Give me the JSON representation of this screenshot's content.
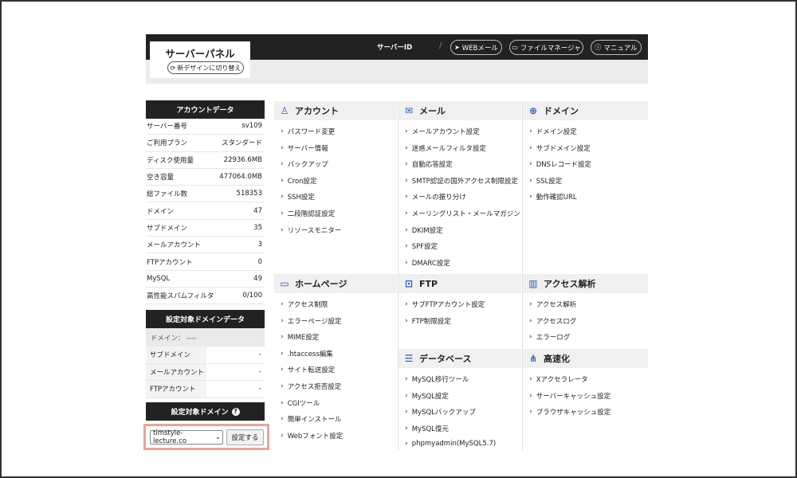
{
  "header": {
    "title": "サーバーパネル",
    "switch_label": "新デザインに切り替え",
    "server_id_label": "サーバーID",
    "slash": "/",
    "webmail_label": "WEBメール",
    "filemanager_label": "ファイルマネージャ",
    "manual_label": "マニュアル"
  },
  "account": {
    "title": "アカウントデータ",
    "rows": [
      {
        "label": "サーバー番号",
        "value": "sv109"
      },
      {
        "label": "ご利用プラン",
        "value": "スタンダード"
      },
      {
        "label": "ディスク使用量",
        "value": "22936.6MB"
      },
      {
        "label": "空き容量",
        "value": "477064.0MB"
      },
      {
        "label": "総ファイル数",
        "value": "518353"
      },
      {
        "label": "ドメイン",
        "value": "47"
      },
      {
        "label": "サブドメイン",
        "value": "35"
      },
      {
        "label": "メールアカウント",
        "value": "3"
      },
      {
        "label": "FTPアカウント",
        "value": "0"
      },
      {
        "label": "MySQL",
        "value": "49"
      },
      {
        "label": "高性能スパムフィルタ",
        "value": "0/100"
      }
    ]
  },
  "domain_data": {
    "title": "設定対象ドメインデータ",
    "domain_line": "ドメイン： ----",
    "rows": [
      {
        "label": "サブドメイン",
        "value": "-"
      },
      {
        "label": "メールアカウント",
        "value": "-"
      },
      {
        "label": "FTPアカウント",
        "value": "-"
      }
    ]
  },
  "target_domain": {
    "title": "設定対象ドメイン",
    "help": "?",
    "selected": "timstyle-lecture.co",
    "apply_label": "設定する"
  },
  "sections": {
    "account": {
      "title": "アカウント",
      "items": [
        "パスワード変更",
        "サーバー情報",
        "バックアップ",
        "Cron設定",
        "SSH設定",
        "二段階認証設定",
        "リソースモニター"
      ]
    },
    "mail": {
      "title": "メール",
      "items": [
        "メールアカウント設定",
        "迷惑メールフィルタ設定",
        "自動応答設定",
        "SMTP認証の国外アクセス制限設定",
        "メールの振り分け",
        "メーリングリスト・メールマガジン",
        "DKIM設定",
        "SPF設定",
        "DMARC設定"
      ]
    },
    "domain": {
      "title": "ドメイン",
      "items": [
        "ドメイン設定",
        "サブドメイン設定",
        "DNSレコード設定",
        "SSL設定",
        "動作確認URL"
      ]
    },
    "homepage": {
      "title": "ホームページ",
      "items": [
        "アクセス制限",
        "エラーページ設定",
        "MIME設定",
        ".htaccess編集",
        "サイト転送設定",
        "アクセス拒否設定",
        "CGIツール",
        "簡単インストール",
        "Webフォント設定"
      ]
    },
    "ftp": {
      "title": "FTP",
      "items": [
        "サブFTPアカウント設定",
        "FTP制限設定"
      ]
    },
    "analytics": {
      "title": "アクセス解析",
      "items": [
        "アクセス解析",
        "アクセスログ",
        "エラーログ"
      ]
    },
    "database": {
      "title": "データベース",
      "items": [
        "MySQL移行ツール",
        "MySQL設定",
        "MySQLバックアップ",
        "MySQL復元",
        "phpmyadmin(MySQL5.7)"
      ]
    },
    "speed": {
      "title": "高速化",
      "items": [
        "Xアクセラレータ",
        "サーバーキャッシュ設定",
        "ブラウザキャッシュ設定"
      ]
    }
  }
}
